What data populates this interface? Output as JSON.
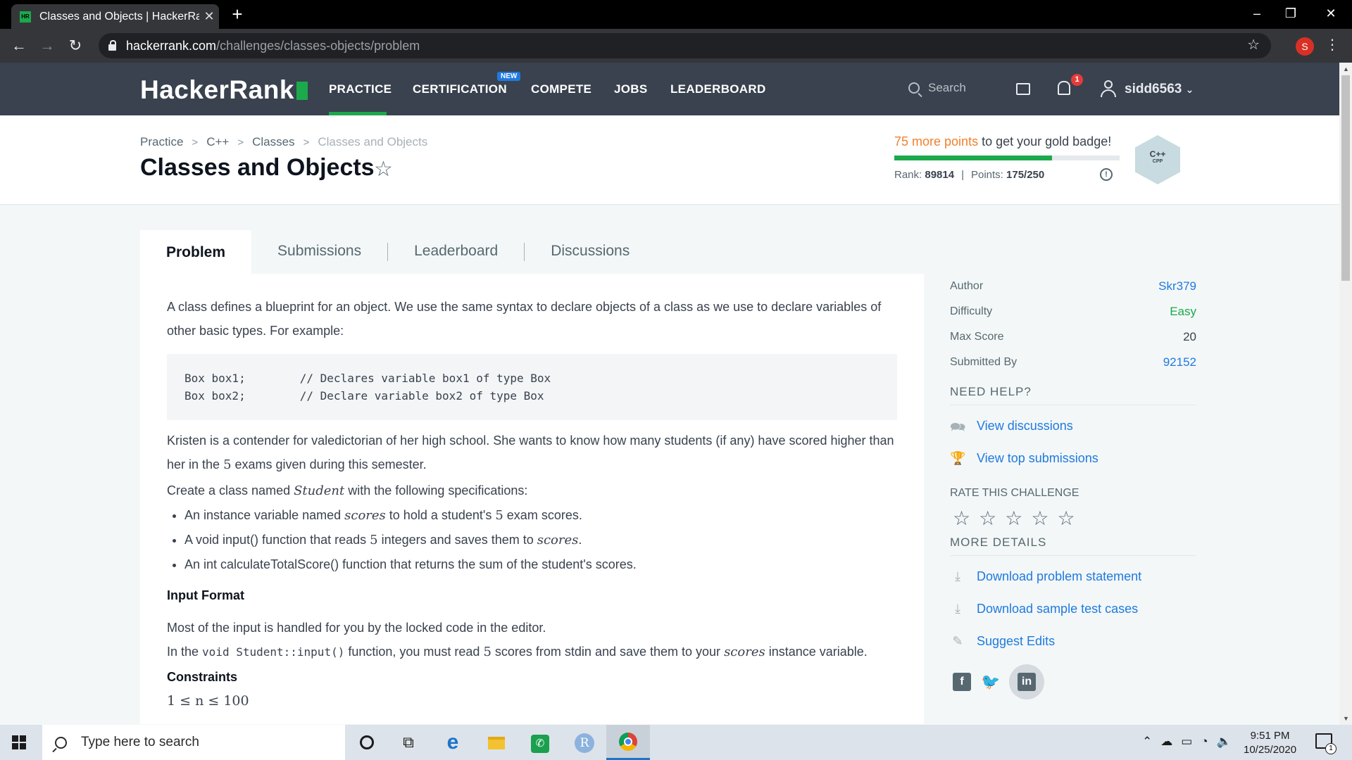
{
  "browser": {
    "tab_title": "Classes and Objects | HackerRank",
    "tab_favicon": "HR",
    "url_host": "hackerrank.com",
    "url_path": "/challenges/classes-objects/problem",
    "profile_initial": "S"
  },
  "header": {
    "logo": "HackerRank",
    "nav": {
      "practice": "PRACTICE",
      "certification": "CERTIFICATION",
      "new_badge": "NEW",
      "compete": "COMPETE",
      "jobs": "JOBS",
      "leaderboard": "LEADERBOARD"
    },
    "search_placeholder": "Search",
    "notification_count": "1",
    "username": "sidd6563"
  },
  "page": {
    "breadcrumbs": [
      "Practice",
      "C++",
      "Classes",
      "Classes and Objects"
    ],
    "title": "Classes and Objects",
    "gold_points": "75 more points",
    "gold_rest": " to get your gold badge!",
    "progress_fraction": 0.7,
    "rank_label": "Rank:",
    "rank_value": "89814",
    "points_label": "Points:",
    "points_value": "175/250",
    "badge_label": "C++",
    "badge_sub": "CPP"
  },
  "tabs": {
    "problem": "Problem",
    "submissions": "Submissions",
    "leaderboard": "Leaderboard",
    "discussions": "Discussions"
  },
  "problem": {
    "intro": "A class defines a blueprint for an object. We use the same syntax to declare objects of a class as we use to declare variables of other basic types. For example:",
    "code": "Box box1;        // Declares variable box1 of type Box\nBox box2;        // Declare variable box2 of type Box",
    "p2_a": "Kristen is a contender for valedictorian of her high school. She wants to know how many students (if any) have scored higher than her in the ",
    "p2_num": "5",
    "p2_b": " exams given during this semester.",
    "p3_a": "Create a class named ",
    "p3_math": "Student",
    "p3_b": " with the following specifications:",
    "li1_a": "An instance variable named ",
    "li1_math": "scores",
    "li1_b": " to hold a student's ",
    "li1_num": "5",
    "li1_c": " exam scores.",
    "li2_a": "A void input() function that reads ",
    "li2_num": "5",
    "li2_b": " integers and saves them to ",
    "li2_math": "scores",
    "li2_c": ".",
    "li3": "An int calculateTotalScore() function that returns the sum of the student's scores.",
    "input_format_heading": "Input Format",
    "input_p1": "Most of the input is handled for you by the locked code in the editor.",
    "input_p2_a": "In the ",
    "input_p2_code": "void Student::input()",
    "input_p2_b": " function, you must read ",
    "input_p2_num": "5",
    "input_p2_c": " scores from stdin and save them to your ",
    "input_p2_math": "scores",
    "input_p2_d": " instance variable.",
    "constraints_heading": "Constraints",
    "constraint": "1 ≤ n ≤ 100"
  },
  "sidebar": {
    "author_label": "Author",
    "author_value": "Skr379",
    "difficulty_label": "Difficulty",
    "difficulty_value": "Easy",
    "max_score_label": "Max Score",
    "max_score_value": "20",
    "submitted_label": "Submitted By",
    "submitted_value": "92152",
    "need_help": "NEED HELP?",
    "view_discussions": "View discussions",
    "view_top_submissions": "View top submissions",
    "rate_heading": "RATE THIS CHALLENGE",
    "more_details": "MORE DETAILS",
    "download_statement": "Download problem statement",
    "download_tests": "Download sample test cases",
    "suggest_edits": "Suggest Edits",
    "colors": {
      "link": "#1f7ae0",
      "easy": "#1ba94c",
      "accent": "#1ba94c",
      "gold": "#f1802d"
    }
  },
  "taskbar": {
    "search_placeholder": "Type here to search",
    "time": "9:51 PM",
    "date": "10/25/2020",
    "action_center_count": "1"
  }
}
